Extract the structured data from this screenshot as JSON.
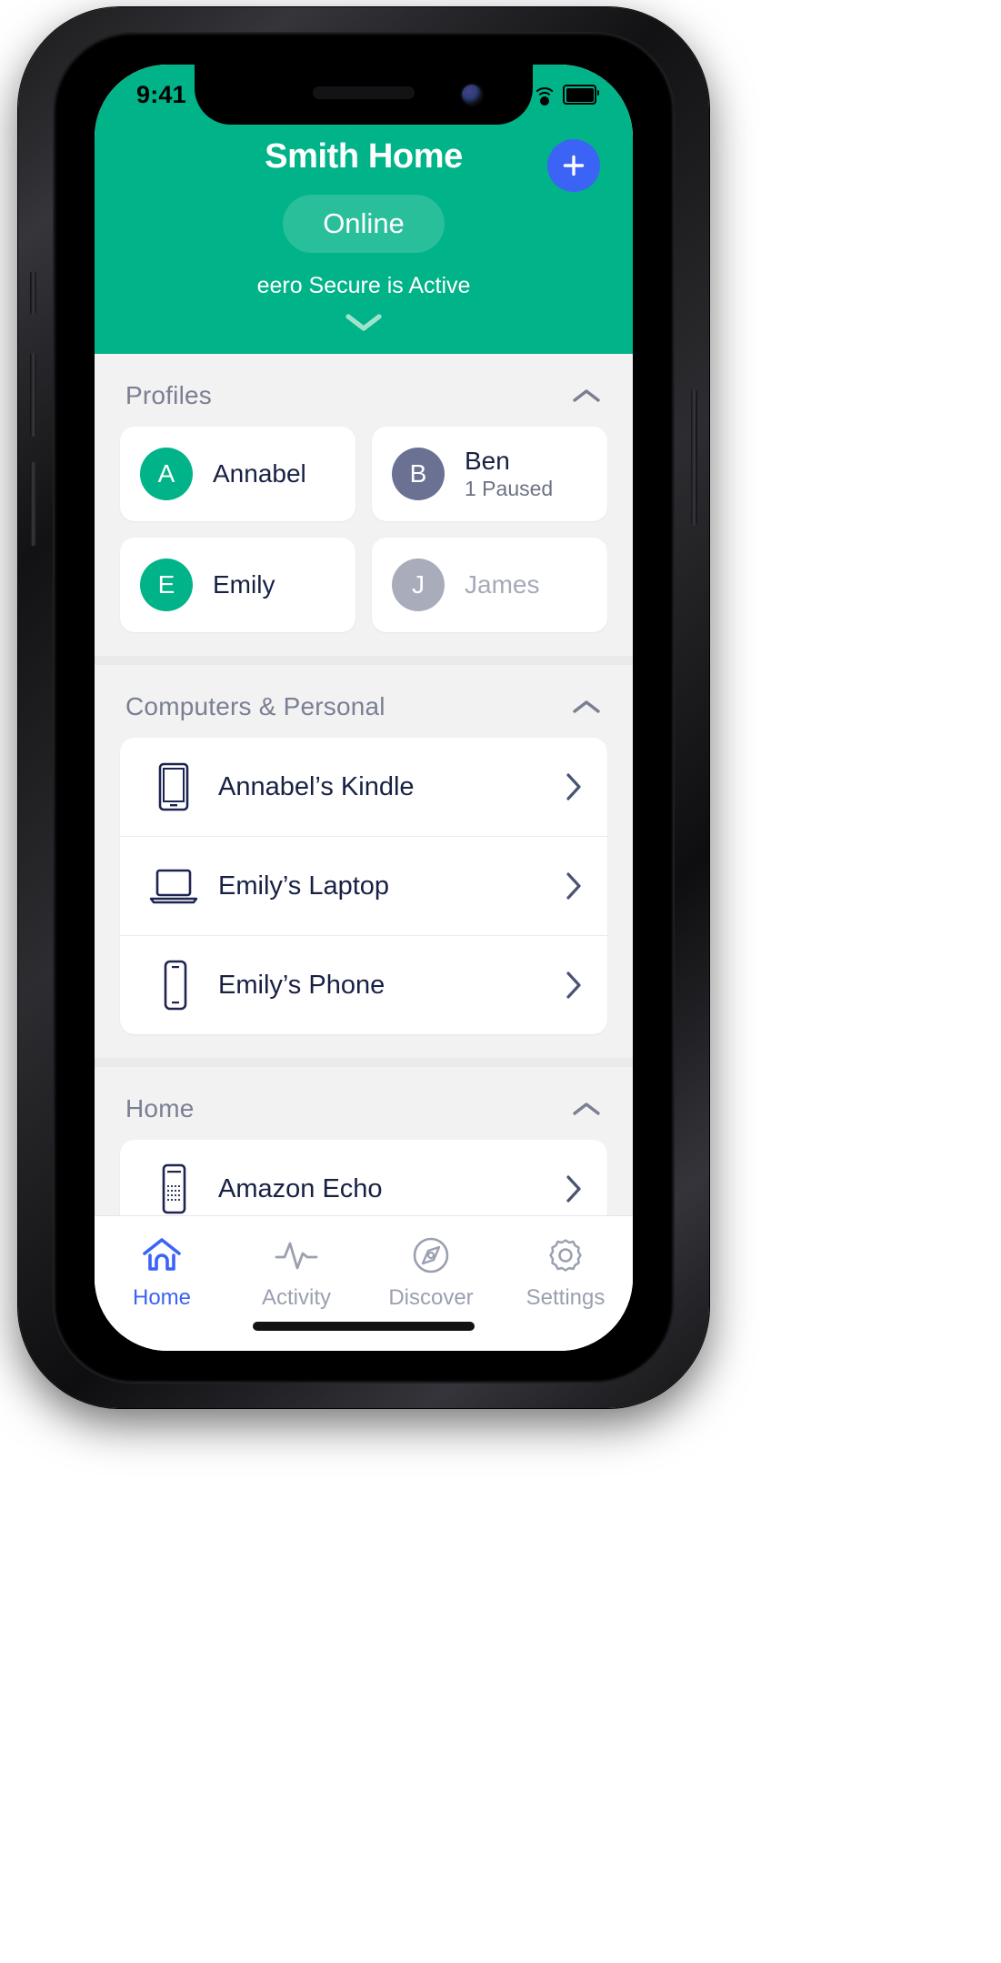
{
  "status_bar": {
    "time": "9:41",
    "signal_icon": "cellular-bars-icon",
    "wifi_icon": "wifi-icon",
    "battery_icon": "battery-full-icon"
  },
  "header": {
    "title": "Smith Home",
    "status_pill": "Online",
    "secure_text": "eero Secure is Active",
    "add_button_label": "+",
    "add_button_icon": "plus-icon",
    "expand_icon": "chevron-down-icon",
    "accent_green": "#00b388",
    "accent_blue": "#3b63f6"
  },
  "sections": [
    {
      "title": "Profiles",
      "collapse_icon": "chevron-up-icon",
      "type": "profiles",
      "profiles": [
        {
          "initial": "A",
          "name": "Annabel",
          "sub": "",
          "avatar_color": "#00b388",
          "muted": false
        },
        {
          "initial": "B",
          "name": "Ben",
          "sub": "1 Paused",
          "avatar_color": "#6b7193",
          "muted": false
        },
        {
          "initial": "E",
          "name": "Emily",
          "sub": "",
          "avatar_color": "#00b388",
          "muted": false
        },
        {
          "initial": "J",
          "name": "James",
          "sub": "",
          "avatar_color": "#a8acbb",
          "muted": true
        }
      ]
    },
    {
      "title": "Computers & Personal",
      "collapse_icon": "chevron-up-icon",
      "type": "devices",
      "devices": [
        {
          "name": "Annabel’s Kindle",
          "icon": "tablet-icon",
          "chevron": "chevron-right-icon"
        },
        {
          "name": "Emily’s Laptop",
          "icon": "laptop-icon",
          "chevron": "chevron-right-icon"
        },
        {
          "name": "Emily’s Phone",
          "icon": "phone-icon",
          "chevron": "chevron-right-icon"
        }
      ]
    },
    {
      "title": "Home",
      "collapse_icon": "chevron-up-icon",
      "type": "devices",
      "devices": [
        {
          "name": "Amazon Echo",
          "icon": "speaker-icon",
          "chevron": "chevron-right-icon"
        }
      ]
    }
  ],
  "tab_bar": [
    {
      "label": "Home",
      "icon": "house-icon",
      "active": true
    },
    {
      "label": "Activity",
      "icon": "pulse-icon",
      "active": false
    },
    {
      "label": "Discover",
      "icon": "compass-icon",
      "active": false
    },
    {
      "label": "Settings",
      "icon": "gear-icon",
      "active": false
    }
  ]
}
